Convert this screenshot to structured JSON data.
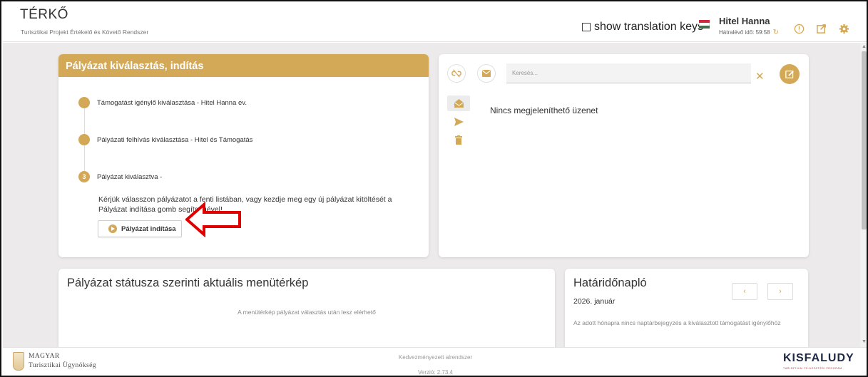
{
  "header": {
    "title": "TÉRKŐ",
    "subtitle": "Turisztikai Projekt Értékelő és Követő Rendszer",
    "translation_toggle": "show translation keys",
    "user_name": "Hitel Hanna",
    "session_label": "Hátralévő idő: 59:58",
    "icons": [
      "info-icon",
      "external-link-icon",
      "gear-icon"
    ]
  },
  "application_card": {
    "title": "Pályázat kiválasztás, indítás",
    "steps": [
      {
        "number": "",
        "label": "Támogatást igénylő kiválasztása - Hitel Hanna ev."
      },
      {
        "number": "",
        "label": "Pályázati felhívás kiválasztása - Hitel és Támogatás"
      },
      {
        "number": "3",
        "label": "Pályázat kiválasztva -"
      }
    ],
    "instruction": "Kérjük válasszon pályázatot a fenti listában, vagy kezdje meg egy új pályázat kitöltését a Pályázat indítása gomb segítségével!",
    "start_button": "Pályázat indítása"
  },
  "messages_card": {
    "search_placeholder": "Keresés...",
    "empty_text": "Nincs megjeleníthető üzenet",
    "folders": [
      "inbox-icon",
      "send-icon",
      "trash-icon"
    ]
  },
  "menu_map": {
    "title": "Pályázat státusza szerinti aktuális menütérkép",
    "note": "A menütérkép pályázat választás után lesz elérhető"
  },
  "deadline_log": {
    "title": "Határidőnapló",
    "month": "2026. január",
    "prev": "‹",
    "next": "›",
    "note": "Az adott hónapra nincs naptárbejegyzés a kiválasztott támogatást igénylőhöz"
  },
  "footer": {
    "left_logo_line1": "Magyar",
    "left_logo_line2": "Turisztikai Ügynökség",
    "center_line1": "Kedvezményezett alrendszer",
    "center_line2": "Verzió: 2.73.4",
    "right_logo": "KISFALUDY",
    "right_logo_sub": "TURISZTIKAI FEJLESZTÉSI PROGRAM"
  },
  "colors": {
    "accent": "#d3a857",
    "background": "#eceaea",
    "annotation": "#e00000"
  }
}
